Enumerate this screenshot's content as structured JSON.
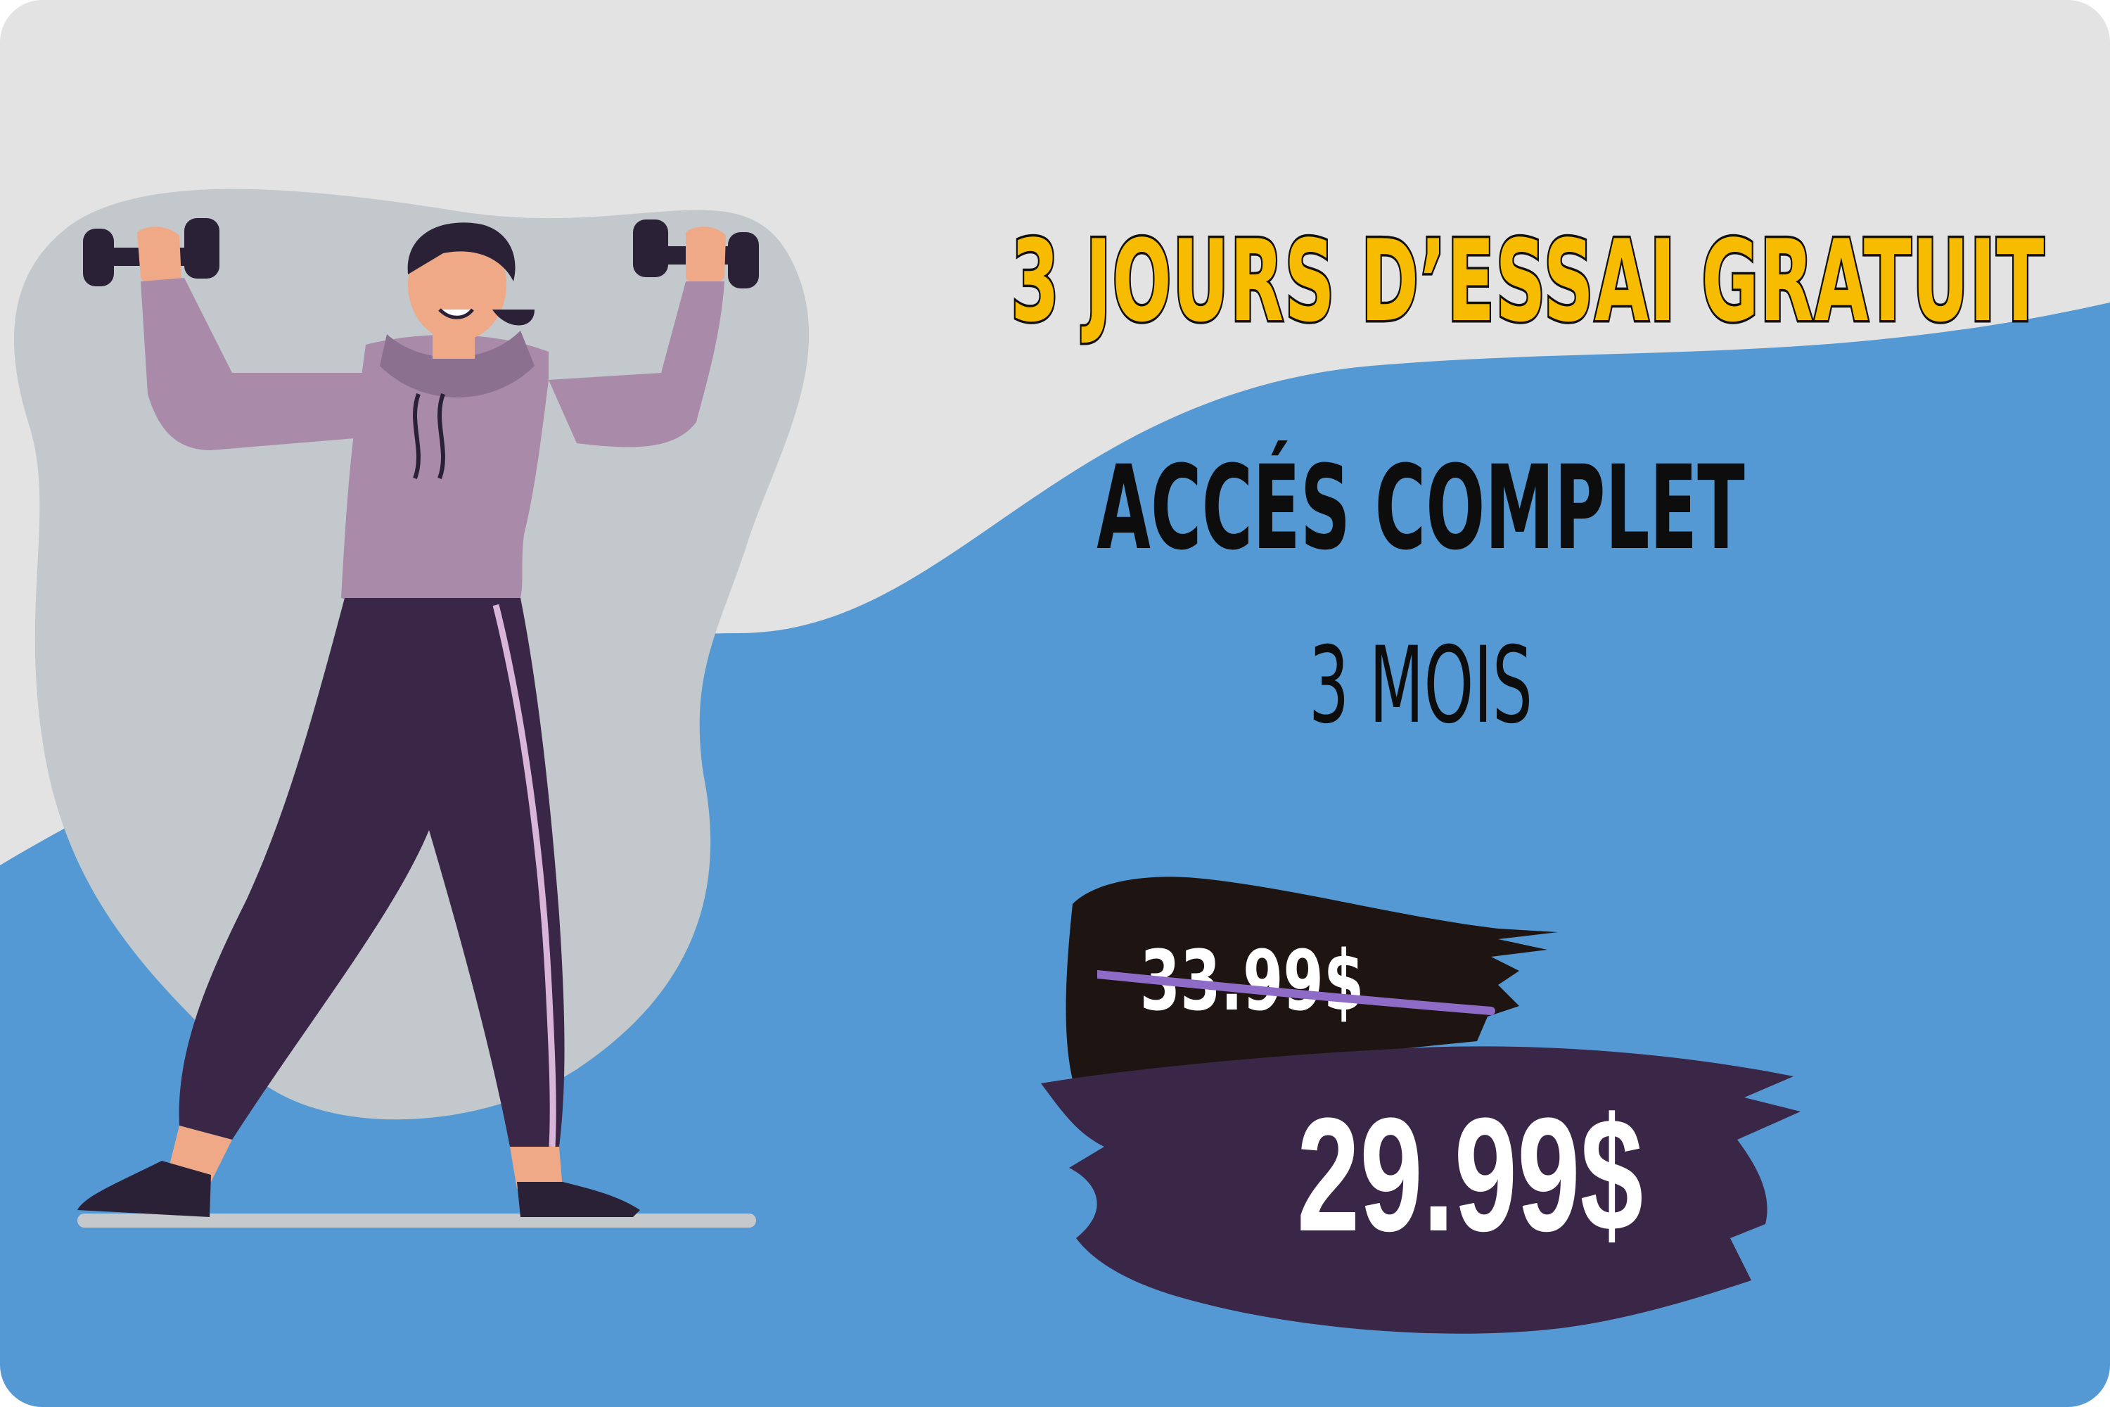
{
  "promo": {
    "headline": "3 JOURS D’ESSAI GRATUIT",
    "access_label": "ACCÉS COMPLET",
    "duration_label": "3 MOIS",
    "old_price": "33.99$",
    "new_price": "29.99$"
  },
  "colors": {
    "background_top": "#e3e3e3",
    "background_wave": "#5499d3",
    "blob": "#c2c8cb",
    "headline_fill": "#f7bb00",
    "headline_stroke": "#111111",
    "text_dark": "#0d0d0d",
    "brush_old_price": "#1e1512",
    "brush_new_price": "#3a2646",
    "strike_line": "#8f6bc8",
    "price_text": "#ffffff",
    "hoodie": "#a98ba9",
    "pants": "#3a2646",
    "skin": "#f0a986"
  },
  "illustration": {
    "figure": "woman-lifting-dumbbells-icon"
  }
}
